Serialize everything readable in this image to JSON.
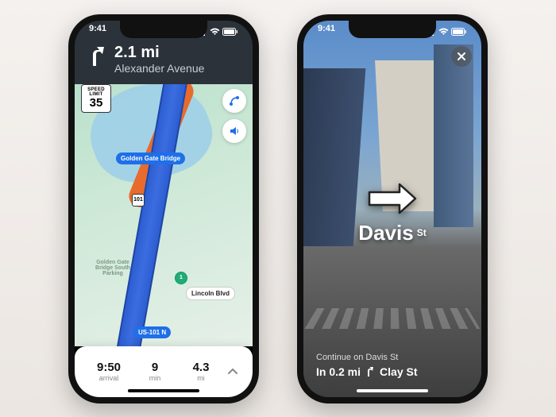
{
  "status": {
    "time": "9:41"
  },
  "left": {
    "nav": {
      "distance": "2.1 mi",
      "street": "Alexander Avenue"
    },
    "speed_limit": {
      "label": "SPEED LIMIT",
      "value": "35"
    },
    "labels": {
      "ggb": "Golden Gate Bridge",
      "lincoln": "Lincoln Blvd",
      "us101": "US-101 N",
      "parking": "Golden Gate Bridge South Parking",
      "shield_101": "101",
      "shield_1": "1"
    },
    "eta": {
      "arrival_value": "9:50",
      "arrival_label": "arrival",
      "time_value": "9",
      "time_label": "min",
      "dist_value": "4.3",
      "dist_label": "mi"
    }
  },
  "right": {
    "ar": {
      "street": "Davis",
      "suffix": "St"
    },
    "footer": {
      "continue": "Continue on Davis St",
      "in_dist": "In 0.2 mi",
      "next": "Clay St"
    }
  }
}
